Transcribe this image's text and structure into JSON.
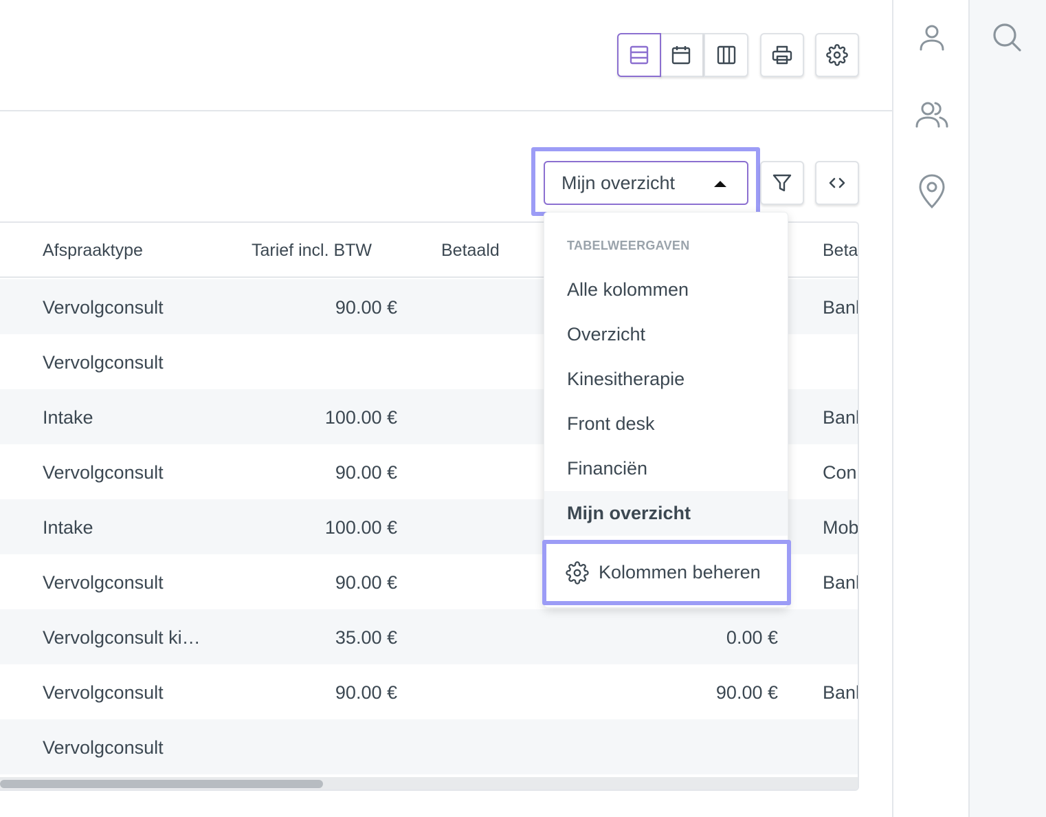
{
  "toolbar": {
    "view_modes": [
      "list-view-icon",
      "calendar-view-icon",
      "columns-view-icon"
    ],
    "active_view": "list-view-icon",
    "print_icon": "printer-icon",
    "settings_icon": "gear-icon"
  },
  "view_selector": {
    "selected": "Mijn overzicht",
    "filter_icon": "filter-icon",
    "code_icon": "code-icon"
  },
  "table": {
    "headers": {
      "type": "Afspraaktype",
      "price": "Tarief incl. BTW",
      "paid": "Betaald",
      "method": "Beta"
    },
    "rows": [
      {
        "type": "Vervolgconsult",
        "price": "90.00 €",
        "paid": "green",
        "amount": "",
        "method": "Banl"
      },
      {
        "type": "Vervolgconsult",
        "price": "",
        "paid": "",
        "amount": "",
        "method": ""
      },
      {
        "type": "Intake",
        "price": "100.00 €",
        "paid": "green",
        "amount": "",
        "method": "Banl"
      },
      {
        "type": "Vervolgconsult",
        "price": "90.00 €",
        "paid": "orange",
        "amount": "",
        "method": "Con"
      },
      {
        "type": "Intake",
        "price": "100.00 €",
        "paid": "green",
        "amount": "",
        "method": "Mob"
      },
      {
        "type": "Vervolgconsult",
        "price": "90.00 €",
        "paid": "green",
        "amount": "",
        "method": "Banl"
      },
      {
        "type": "Vervolgconsult ki…",
        "price": "35.00 €",
        "paid": "red",
        "amount": "0.00 €",
        "method": ""
      },
      {
        "type": "Vervolgconsult",
        "price": "90.00 €",
        "paid": "green",
        "amount": "90.00 €",
        "method": "Banl"
      },
      {
        "type": "Vervolgconsult",
        "price": "",
        "paid": "",
        "amount": "",
        "method": ""
      }
    ],
    "status_colors": {
      "green": "#5fcaa6",
      "orange": "#e8b040",
      "red": "#e84560"
    }
  },
  "dropdown": {
    "header": "TABELWEERGAVEN",
    "items": [
      "Alle kolommen",
      "Overzicht",
      "Kinesitherapie",
      "Front desk",
      "Financiën",
      "Mijn overzicht"
    ],
    "active_item": "Mijn overzicht",
    "footer_label": "Kolommen beheren"
  },
  "sidebar": {
    "icons": [
      "user-icon",
      "users-icon",
      "location-pin-icon"
    ],
    "search_icon": "search-icon"
  },
  "colors": {
    "accent": "#8b6fd0",
    "highlight": "#9c9cf6",
    "text": "#3c4852"
  }
}
